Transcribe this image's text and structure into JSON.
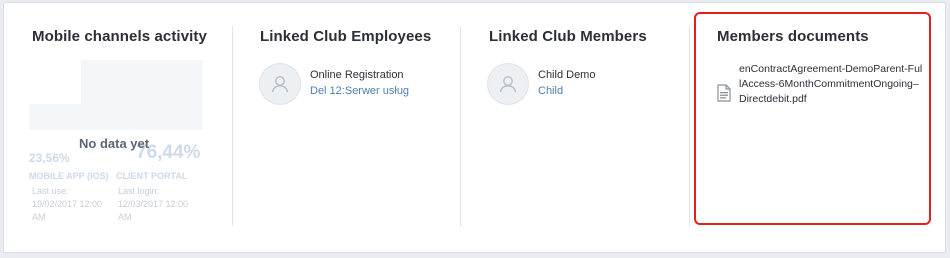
{
  "columns": {
    "mobile": {
      "title": "Mobile channels activity",
      "no_data": "No data yet",
      "app_percent": "23,56%",
      "portal_percent": "76,44%",
      "app_label": "MOBILE APP (IOS)",
      "portal_label": "CLIENT PORTAL",
      "last_use_label": "Last use:",
      "last_use_value_1": "19/02/2017 12:00",
      "last_use_value_2": "AM",
      "last_login_label": "Last login:",
      "last_login_value_1": "12/03/2017 12:00",
      "last_login_value_2": "AM"
    },
    "employees": {
      "title": "Linked Club Employees",
      "name": "Online Registration",
      "role": "Del 12:Serwer usług"
    },
    "members": {
      "title": "Linked Club Members",
      "name": "Child Demo",
      "relation": "Child"
    },
    "documents": {
      "title": "Members documents",
      "file_name": "enContractAgreement-DemoParent-FullAccess-6MonthCommitmentOngoing–Directdebit.pdf",
      "file_icon": "pdf-file-icon"
    }
  },
  "colors": {
    "highlight": "#e32020",
    "link": "#4d7fb0",
    "faded": "#ced9ea"
  }
}
